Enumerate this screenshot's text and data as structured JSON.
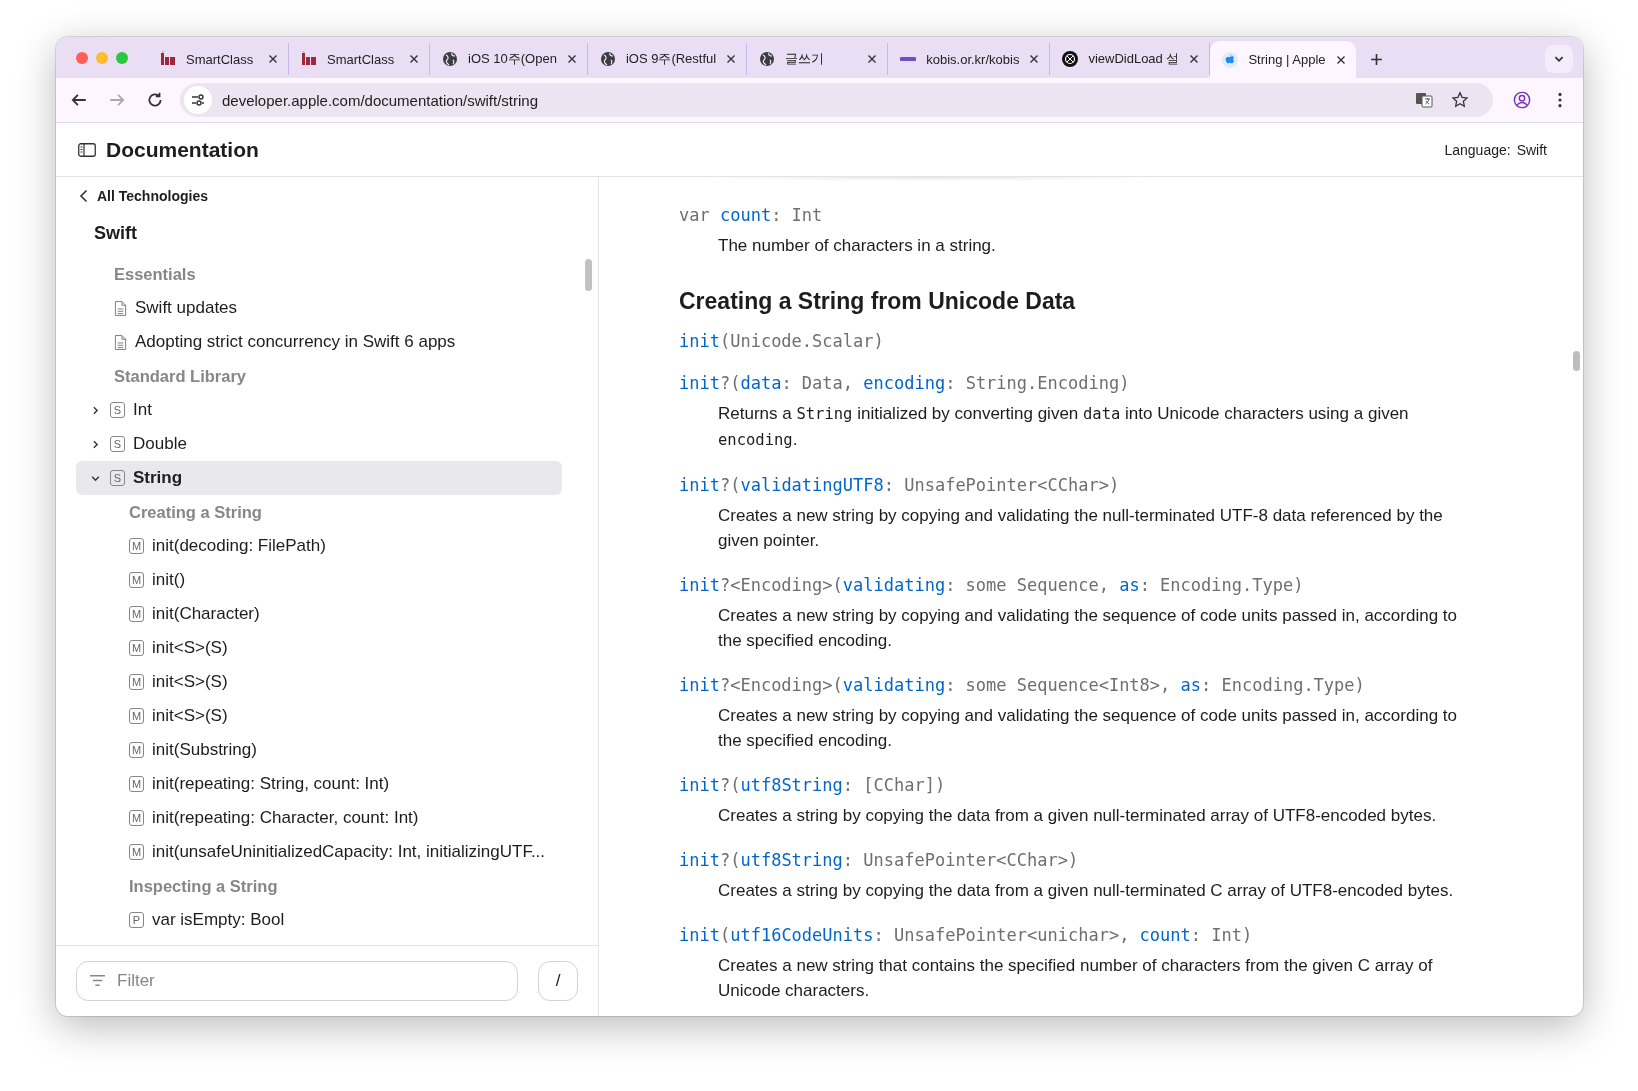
{
  "browser": {
    "tabs": [
      {
        "title": "SmartClass",
        "kind": "edu",
        "selected": false
      },
      {
        "title": "SmartClass",
        "kind": "edu",
        "selected": false
      },
      {
        "title": "iOS 10주(Open",
        "kind": "globe",
        "selected": false
      },
      {
        "title": "iOS 9주(Restful",
        "kind": "globe",
        "selected": false
      },
      {
        "title": "글쓰기",
        "kind": "globe",
        "selected": false
      },
      {
        "title": "kobis.or.kr/kobis",
        "kind": "kobis",
        "selected": false
      },
      {
        "title": "viewDidLoad 설",
        "kind": "knot",
        "selected": false
      },
      {
        "title": "String | Apple",
        "kind": "apple",
        "selected": true
      }
    ],
    "url": "developer.apple.com/documentation/swift/string"
  },
  "header": {
    "title": "Documentation",
    "language_label": "Language:",
    "language": "Swift"
  },
  "sidebar": {
    "back_link": "All Technologies",
    "title": "Swift",
    "items": [
      {
        "kind": "section",
        "label": "Essentials"
      },
      {
        "kind": "doc",
        "label": "Swift updates"
      },
      {
        "kind": "doc",
        "label": "Adopting strict concurrency in Swift 6 apps"
      },
      {
        "kind": "section",
        "label": "Standard Library"
      },
      {
        "kind": "struct",
        "badge": "S",
        "label": "Int",
        "expanded": false,
        "selected": false
      },
      {
        "kind": "struct",
        "badge": "S",
        "label": "Double",
        "expanded": false,
        "selected": false
      },
      {
        "kind": "struct",
        "badge": "S",
        "label": "String",
        "expanded": true,
        "selected": true,
        "children": [
          {
            "kind": "section",
            "label": "Creating a String"
          },
          {
            "kind": "member",
            "badge": "M",
            "label": "init(decoding: FilePath)"
          },
          {
            "kind": "member",
            "badge": "M",
            "label": "init()"
          },
          {
            "kind": "member",
            "badge": "M",
            "label": "init(Character)"
          },
          {
            "kind": "member",
            "badge": "M",
            "label": "init<S>(S)"
          },
          {
            "kind": "member",
            "badge": "M",
            "label": "init<S>(S)"
          },
          {
            "kind": "member",
            "badge": "M",
            "label": "init<S>(S)"
          },
          {
            "kind": "member",
            "badge": "M",
            "label": "init(Substring)"
          },
          {
            "kind": "member",
            "badge": "M",
            "label": "init(repeating: String, count: Int)"
          },
          {
            "kind": "member",
            "badge": "M",
            "label": "init(repeating: Character, count: Int)"
          },
          {
            "kind": "member",
            "badge": "M",
            "label": "init(unsafeUninitializedCapacity: Int, initializingUTF..."
          },
          {
            "kind": "section",
            "label": "Inspecting a String"
          },
          {
            "kind": "member",
            "badge": "P",
            "label": "var isEmpty: Bool"
          }
        ]
      }
    ],
    "filter_placeholder": "Filter",
    "shortcut": "/"
  },
  "content": [
    {
      "kind": "symbol",
      "signature": [
        {
          "t": "var ",
          "kind": "plain"
        },
        {
          "t": "count",
          "kind": "name"
        },
        {
          "t": ": Int",
          "kind": "plain"
        }
      ],
      "description": [
        {
          "t": "The number of characters in a string.",
          "kind": "text"
        }
      ]
    },
    {
      "kind": "heading",
      "text": "Creating a String from Unicode Data"
    },
    {
      "kind": "symbol",
      "signature": [
        {
          "t": "init",
          "kind": "name"
        },
        {
          "t": "(Unicode.Scalar)",
          "kind": "plain"
        }
      ]
    },
    {
      "kind": "symbol",
      "signature": [
        {
          "t": "init",
          "kind": "name"
        },
        {
          "t": "?(",
          "kind": "plain"
        },
        {
          "t": "data",
          "kind": "name"
        },
        {
          "t": ": Data, ",
          "kind": "plain"
        },
        {
          "t": "encoding",
          "kind": "name"
        },
        {
          "t": ": String.Encoding)",
          "kind": "plain"
        }
      ],
      "description": [
        {
          "t": "Returns a ",
          "kind": "text"
        },
        {
          "t": "String",
          "kind": "code"
        },
        {
          "t": " initialized by converting given ",
          "kind": "text"
        },
        {
          "t": "data",
          "kind": "code"
        },
        {
          "t": " into Unicode characters using a given ",
          "kind": "text"
        },
        {
          "t": "encoding",
          "kind": "code"
        },
        {
          "t": ".",
          "kind": "text"
        }
      ]
    },
    {
      "kind": "symbol",
      "signature": [
        {
          "t": "init",
          "kind": "name"
        },
        {
          "t": "?(",
          "kind": "plain"
        },
        {
          "t": "validatingUTF8",
          "kind": "name"
        },
        {
          "t": ": UnsafePointer<CChar>)",
          "kind": "plain"
        }
      ],
      "description": [
        {
          "t": "Creates a new string by copying and validating the null-terminated UTF-8 data referenced by the given pointer.",
          "kind": "text"
        }
      ]
    },
    {
      "kind": "symbol",
      "signature": [
        {
          "t": "init",
          "kind": "name"
        },
        {
          "t": "?<Encoding>(",
          "kind": "plain"
        },
        {
          "t": "validating",
          "kind": "name"
        },
        {
          "t": ": some Sequence, ",
          "kind": "plain"
        },
        {
          "t": "as",
          "kind": "name"
        },
        {
          "t": ": Encoding.Type)",
          "kind": "plain"
        }
      ],
      "description": [
        {
          "t": "Creates a new string by copying and validating the sequence of code units passed in, according to the specified encoding.",
          "kind": "text"
        }
      ]
    },
    {
      "kind": "symbol",
      "signature": [
        {
          "t": "init",
          "kind": "name"
        },
        {
          "t": "?<Encoding>(",
          "kind": "plain"
        },
        {
          "t": "validating",
          "kind": "name"
        },
        {
          "t": ": some Sequence<Int8>, ",
          "kind": "plain"
        },
        {
          "t": "as",
          "kind": "name"
        },
        {
          "t": ": Encoding.Type)",
          "kind": "plain"
        }
      ],
      "description": [
        {
          "t": "Creates a new string by copying and validating the sequence of code units passed in, according to the specified encoding.",
          "kind": "text"
        }
      ]
    },
    {
      "kind": "symbol",
      "signature": [
        {
          "t": "init",
          "kind": "name"
        },
        {
          "t": "?(",
          "kind": "plain"
        },
        {
          "t": "utf8String",
          "kind": "name"
        },
        {
          "t": ": [CChar])",
          "kind": "plain"
        }
      ],
      "description": [
        {
          "t": "Creates a string by copying the data from a given null-terminated array of UTF8-encoded bytes.",
          "kind": "text"
        }
      ]
    },
    {
      "kind": "symbol",
      "signature": [
        {
          "t": "init",
          "kind": "name"
        },
        {
          "t": "?(",
          "kind": "plain"
        },
        {
          "t": "utf8String",
          "kind": "name"
        },
        {
          "t": ": UnsafePointer<CChar>)",
          "kind": "plain"
        }
      ],
      "description": [
        {
          "t": "Creates a string by copying the data from a given null-terminated C array of UTF8-encoded bytes.",
          "kind": "text"
        }
      ]
    },
    {
      "kind": "symbol",
      "signature": [
        {
          "t": "init",
          "kind": "name"
        },
        {
          "t": "(",
          "kind": "plain"
        },
        {
          "t": "utf16CodeUnits",
          "kind": "name"
        },
        {
          "t": ": UnsafePointer<unichar>, ",
          "kind": "plain"
        },
        {
          "t": "count",
          "kind": "name"
        },
        {
          "t": ": Int)",
          "kind": "plain"
        }
      ],
      "description": [
        {
          "t": "Creates a new string that contains the specified number of characters from the given C array of Unicode characters.",
          "kind": "text"
        }
      ]
    }
  ]
}
